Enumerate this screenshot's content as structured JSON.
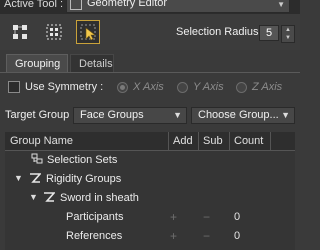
{
  "topbar": {
    "active_tool_label": "Active Tool :",
    "tool_name": "Geometry Editor"
  },
  "toolbar": {
    "buttons": [
      {
        "name": "node-select-icon"
      },
      {
        "name": "region-select-icon"
      },
      {
        "name": "pointer-select-icon",
        "active": true
      }
    ],
    "selection_radius_label": "Selection Radius :",
    "selection_radius_value": "5"
  },
  "tabs": [
    {
      "label": "Grouping",
      "active": true
    },
    {
      "label": "Details",
      "active": false
    }
  ],
  "symmetry": {
    "label": "Use Symmetry :",
    "checked": false,
    "options": [
      "X Axis",
      "Y Axis",
      "Z Axis"
    ],
    "selected": "X Axis"
  },
  "target_group": {
    "label": "Target Group :",
    "value": "Face Groups",
    "choose_label": "Choose Group..."
  },
  "table": {
    "headers": {
      "name": "Group Name",
      "add": "Add",
      "sub": "Sub",
      "count": "Count"
    },
    "rows": [
      {
        "label": "Selection Sets",
        "indent": 0,
        "expander": "",
        "icon": "selection-sets-icon",
        "add": "",
        "sub": "",
        "count": ""
      },
      {
        "label": "Rigidity Groups",
        "indent": 0,
        "expander": "▼",
        "icon": "rigidity-groups-icon",
        "add": "",
        "sub": "",
        "count": ""
      },
      {
        "label": "Sword in sheath",
        "indent": 1,
        "expander": "▼",
        "icon": "rigidity-group-icon",
        "add": "",
        "sub": "",
        "count": ""
      },
      {
        "label": "Participants",
        "indent": 2,
        "expander": "",
        "icon": "",
        "add": "+",
        "sub": "−",
        "count": "0"
      },
      {
        "label": "References",
        "indent": 2,
        "expander": "",
        "icon": "",
        "add": "+",
        "sub": "−",
        "count": "0"
      }
    ]
  },
  "colors": {
    "accent": "#c9a23a",
    "panel_bg": "#3a3a3a",
    "header_bg": "#2e2e2e"
  }
}
